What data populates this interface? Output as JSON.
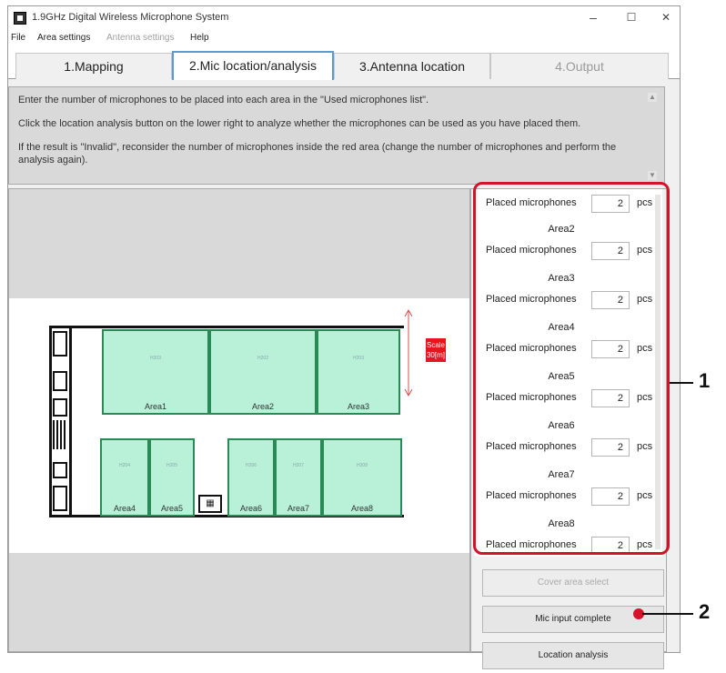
{
  "window": {
    "title": "1.9GHz Digital Wireless Microphone System",
    "minimize": "–",
    "maximize": "☐",
    "close": "✕"
  },
  "menu": [
    "File",
    "Area settings",
    "Antenna settings",
    "Help"
  ],
  "tabs": [
    {
      "label": "1.Mapping",
      "state": "normal"
    },
    {
      "label": "2.Mic location/analysis",
      "state": "active"
    },
    {
      "label": "3.Antenna location",
      "state": "normal"
    },
    {
      "label": "4.Output",
      "state": "disabled"
    }
  ],
  "instructions": {
    "p1": "Enter the number of microphones to be placed into each area in the \"Used microphones list\".",
    "p2": "Click the location analysis button on the lower right to analyze whether the microphones can be used as you have placed them.",
    "p3": "If the result is \"Invalid\", reconsider the number of microphones inside the red area (change the number of microphones and perform the analysis again)."
  },
  "map": {
    "scale_label": "Scale 30[m]",
    "areas": [
      "Area1",
      "Area2",
      "Area3",
      "Area4",
      "Area5",
      "Area6",
      "Area7",
      "Area8"
    ],
    "room_numbers": [
      "H203",
      "H202",
      "H203",
      "H204",
      "H205",
      "H206",
      "H207",
      "H208"
    ]
  },
  "mic_list": {
    "field_label": "Placed microphones",
    "unit": "pcs",
    "rows": [
      {
        "area": "",
        "count": "2"
      },
      {
        "area": "Area2",
        "count": "2"
      },
      {
        "area": "Area3",
        "count": "2"
      },
      {
        "area": "Area4",
        "count": "2"
      },
      {
        "area": "Area5",
        "count": "2"
      },
      {
        "area": "Area6",
        "count": "2"
      },
      {
        "area": "Area7",
        "count": "2"
      },
      {
        "area": "Area8",
        "count": "2"
      }
    ]
  },
  "buttons": {
    "cover_area_select": "Cover area select",
    "mic_input_complete": "Mic input complete",
    "location_analysis": "Location analysis"
  },
  "callouts": {
    "one": "1",
    "two": "2"
  },
  "colors": {
    "callout": "#d4122a",
    "area_fill": "#b8f0d8",
    "active_tab": "#5b9bd5"
  }
}
